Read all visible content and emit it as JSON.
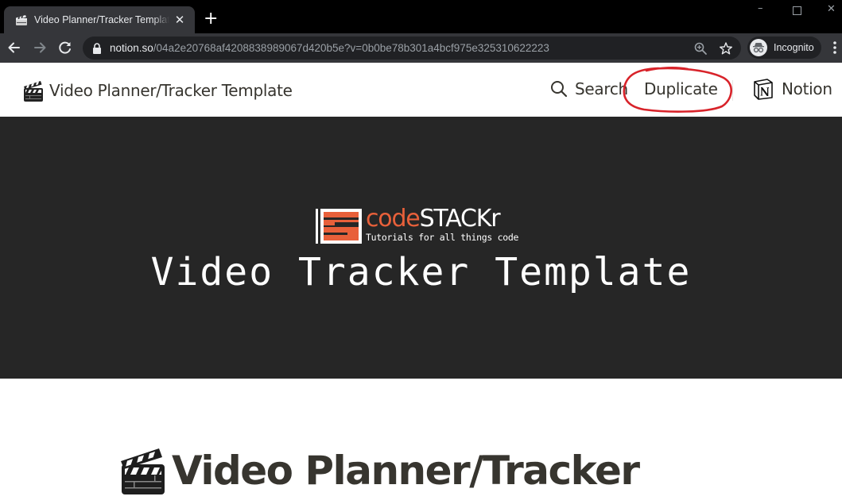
{
  "browser": {
    "tab": {
      "title": "Video Planner/Tracker Template | Notion",
      "favicon": "clapperboard-icon"
    },
    "new_tab_icon": "plus-icon",
    "window_controls": [
      "minimize-icon",
      "maximize-icon",
      "close-icon"
    ],
    "nav": [
      "back-arrow-icon",
      "forward-arrow-icon",
      "reload-icon"
    ],
    "url": {
      "host": "notion.so",
      "path": "/04a2e20768af4208838989067d420b5e?v=0b0be78b301a4bcf975e325310622223"
    },
    "omnibox_icons": [
      "zoom-icon",
      "bookmark-star-icon"
    ],
    "profile": {
      "label": "Incognito",
      "icon": "incognito-icon"
    },
    "menu_icon": "kebab-menu-icon"
  },
  "topbar": {
    "page_icon": "clapperboard-icon",
    "page_title": "Video Planner/Tracker Template",
    "search_label": "Search",
    "duplicate_label": "Duplicate",
    "notion_label": "Notion",
    "annotation_color": "#d8232a"
  },
  "cover": {
    "brand_code": "code",
    "brand_stack": "STACKr",
    "brand_tagline": "Tutorials for all things code",
    "brand_color": "#e8603a",
    "title": "Video Tracker Template",
    "background": "#262626"
  },
  "page": {
    "icon": "clapperboard-icon",
    "title": "Video Planner/Tracker"
  }
}
